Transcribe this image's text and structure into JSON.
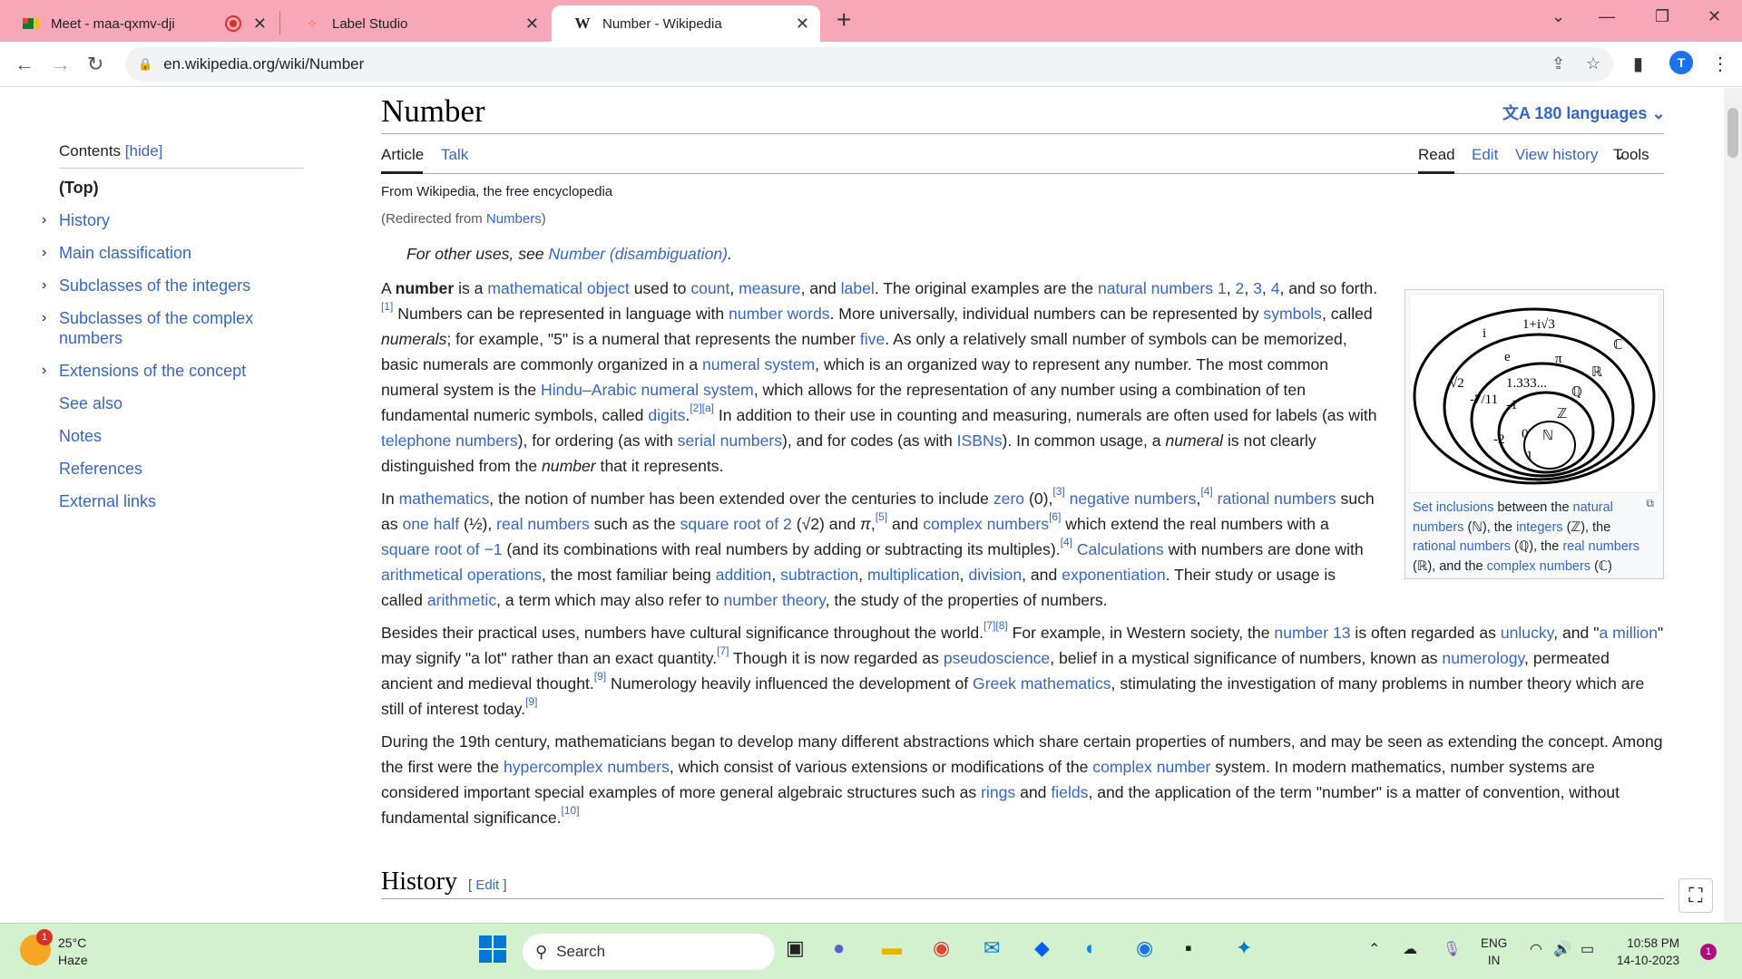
{
  "browser": {
    "tabs": [
      {
        "title": "Meet - maa-qxmv-dji",
        "icon": "meet-icon",
        "recording": true
      },
      {
        "title": "Label Studio",
        "icon": "label-studio-icon"
      },
      {
        "title": "Number - Wikipedia",
        "icon": "W",
        "active": true
      }
    ],
    "url": "en.wikipedia.org/wiki/Number",
    "avatar": "T"
  },
  "toc": {
    "header": "Contents",
    "hide": "[hide]",
    "items": [
      "(Top)",
      "History",
      "Main classification",
      "Subclasses of the integers",
      "Subclasses of the complex numbers",
      "Extensions of the concept",
      "See also",
      "Notes",
      "References",
      "External links"
    ]
  },
  "article": {
    "title": "Number",
    "languages": "180 languages",
    "tabs": {
      "article": "Article",
      "talk": "Talk",
      "read": "Read",
      "edit": "Edit",
      "history": "View history",
      "tools": "Tools"
    },
    "tagline": "From Wikipedia, the free encyclopedia",
    "redirect_prefix": "(Redirected from ",
    "redirect_link": "Numbers",
    "redirect_suffix": ")",
    "hatnote_prefix": "For other uses, see ",
    "hatnote_link": "Number (disambiguation)",
    "section_history": "History",
    "section_edit": "[ edit ]"
  },
  "infobox": {
    "diagram_labels": [
      "i",
      "1+i√3",
      "e",
      "π",
      "√2",
      "1.333...",
      "-7/11",
      "-1",
      "-2",
      "0",
      "1",
      "ℂ",
      "ℝ",
      "ℚ",
      "ℤ",
      "ℕ"
    ],
    "caption_1": "Set inclusions",
    "caption_2": " between the ",
    "caption_3": "natural numbers",
    "caption_4": " (ℕ), the ",
    "caption_5": "integers",
    "caption_6": " (ℤ), the ",
    "caption_7": "rational numbers",
    "caption_8": " (ℚ), the ",
    "caption_9": "real numbers",
    "caption_10": " (ℝ), and the ",
    "caption_11": "complex numbers",
    "caption_12": " (ℂ)"
  },
  "taskbar": {
    "temp": "25°C",
    "weather": "Haze",
    "weather_badge": "1",
    "search": "Search",
    "lang1": "ENG",
    "lang2": "IN",
    "time": "10:58 PM",
    "date": "14-10-2023",
    "notifications": "1"
  }
}
